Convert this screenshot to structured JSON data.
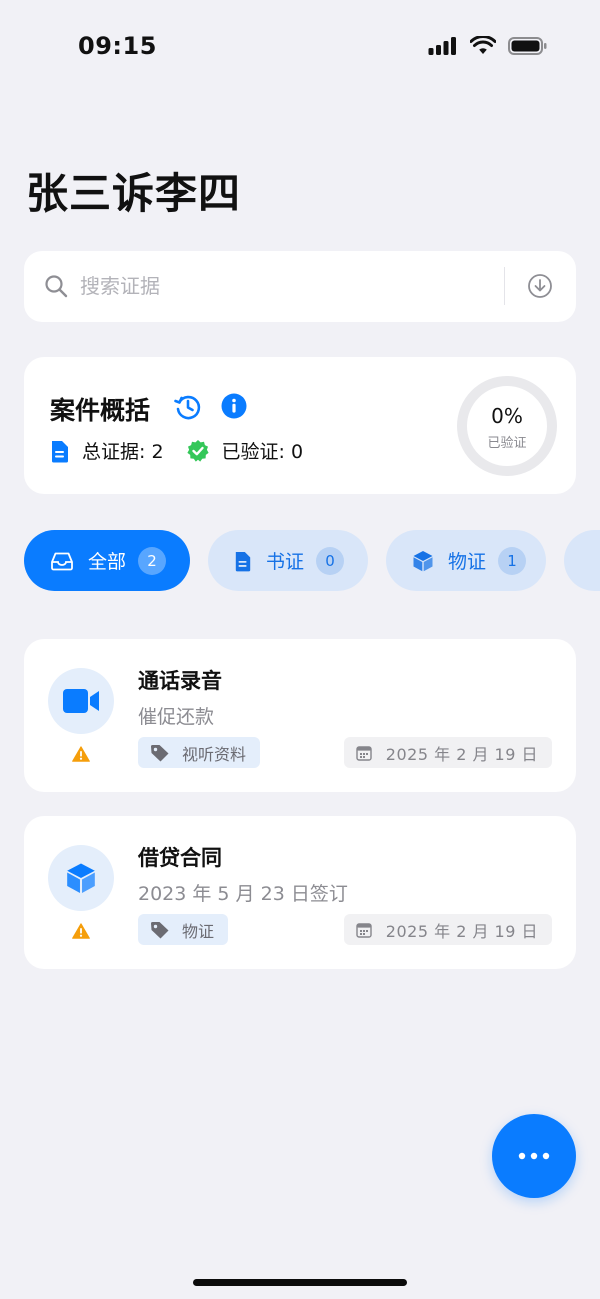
{
  "status_bar": {
    "time": "09:15"
  },
  "page": {
    "title": "张三诉李四"
  },
  "search": {
    "placeholder": "搜索证据"
  },
  "overview": {
    "title": "案件概括",
    "total_label": "总证据: 2",
    "verified_label": "已验证: 0",
    "progress_value": "0%",
    "progress_fraction": 0,
    "progress_label": "已验证"
  },
  "filters": [
    {
      "label": "全部",
      "count": "2",
      "active": true,
      "icon": "inbox-icon"
    },
    {
      "label": "书证",
      "count": "0",
      "active": false,
      "icon": "document-icon"
    },
    {
      "label": "物证",
      "count": "1",
      "active": false,
      "icon": "cube-icon"
    }
  ],
  "evidence": [
    {
      "title": "通话录音",
      "description": "催促还款",
      "tag": "视听资料",
      "date": "2025 年 2 月 19 日",
      "icon": "video-camera-icon",
      "warning": true
    },
    {
      "title": "借贷合同",
      "description": "2023 年 5 月 23 日签订",
      "tag": "物证",
      "date": "2025 年 2 月 19 日",
      "icon": "cube-icon",
      "warning": true
    }
  ],
  "colors": {
    "accent": "#0a7cff",
    "chip_bg": "#d9e6f9",
    "warning": "#f59e0b",
    "verified": "#34c759"
  }
}
